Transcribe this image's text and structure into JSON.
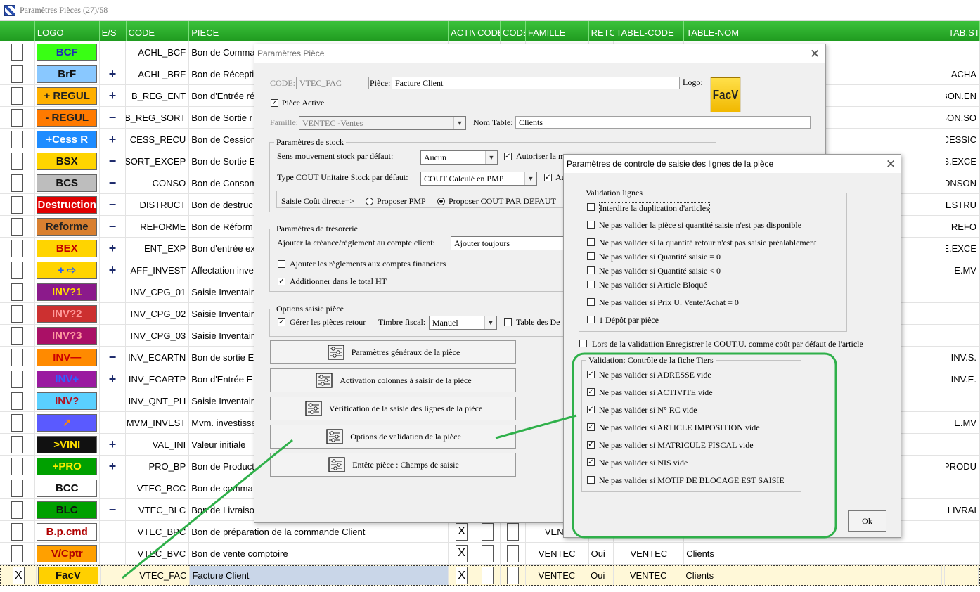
{
  "window": {
    "title": "Paramètres Pièces (27)/58"
  },
  "grid": {
    "columns": [
      "",
      "LOGO",
      "E/S",
      "CODE",
      "PIECE",
      "ACTIV",
      "CODE",
      "CODE",
      "FAMILLE",
      "RETO",
      "TABEL-CODE",
      "TABLE-NOM",
      "",
      "TAB.STO"
    ],
    "rows": [
      {
        "chk": "",
        "logo": "BCF",
        "es": "",
        "code": "ACHL_BCF",
        "piece": "Bon de Comma",
        "tab": ""
      },
      {
        "chk": "",
        "logo": "BrF",
        "es": "+",
        "code": "ACHL_BRF",
        "piece": "Bon de Récepti",
        "tab": "ACHA"
      },
      {
        "chk": "",
        "logo": "+ REGUL",
        "es": "+",
        "code": "B_REG_ENT",
        "piece": "Bon d'Entrée ré",
        "tab": "BON.EN"
      },
      {
        "chk": "",
        "logo": "- REGUL",
        "es": "−",
        "code": "B_REG_SORT",
        "piece": "Bon de Sortie r",
        "tab": "BON.SO"
      },
      {
        "chk": "",
        "logo": "+Cess R",
        "es": "+",
        "code": "CESS_RECU",
        "piece": "Bon de Cession",
        "tab": "CESSIC"
      },
      {
        "chk": "",
        "logo": "BSX",
        "es": "−",
        "code": "SORT_EXCEP",
        "piece": "Bon de Sortie E",
        "tab": "S.EXCE"
      },
      {
        "chk": "",
        "logo": "BCS",
        "es": "−",
        "code": "CONSO",
        "piece": "Bon de Consom",
        "tab": "CONSON"
      },
      {
        "chk": "",
        "logo": "Destruction",
        "es": "−",
        "code": "DISTRUCT",
        "piece": "Bon de destruc",
        "tab": "DESTRU"
      },
      {
        "chk": "",
        "logo": "Reforme",
        "es": "−",
        "code": "REFORME",
        "piece": "Bon de Réform",
        "tab": "REFO"
      },
      {
        "chk": "",
        "logo": "BEX",
        "es": "+",
        "code": "ENT_EXP",
        "piece": "Bon d'entrée ex",
        "tab": "E.EXCE"
      },
      {
        "chk": "",
        "logo": "+ ⇨",
        "es": "+",
        "code": "AFF_INVEST",
        "piece": "Affectation inve",
        "tab": "E.MV"
      },
      {
        "chk": "",
        "logo": "INV?1",
        "es": "",
        "code": "INV_CPG_01",
        "piece": "Saisie Inventair",
        "tab": ""
      },
      {
        "chk": "",
        "logo": "INV?2",
        "es": "",
        "code": "INV_CPG_02",
        "piece": "Saisie Inventair",
        "tab": ""
      },
      {
        "chk": "",
        "logo": "INV?3",
        "es": "",
        "code": "INV_CPG_03",
        "piece": "Saisie Inventair",
        "tab": ""
      },
      {
        "chk": "",
        "logo": "INV—",
        "es": "−",
        "code": "INV_ECARTN",
        "piece": "Bon de sortie E",
        "tab": "INV.S."
      },
      {
        "chk": "",
        "logo": "INV+",
        "es": "+",
        "code": "INV_ECARTP",
        "piece": "Bon d'Entrée E",
        "tab": "INV.E."
      },
      {
        "chk": "",
        "logo": "INV?",
        "es": "",
        "code": "INV_QNT_PH",
        "piece": "Saisie Inventair",
        "tab": ""
      },
      {
        "chk": "",
        "logo": "↗",
        "es": "",
        "code": "MVM_INVEST",
        "piece": "Mvm. investisse",
        "tab": "E.MV"
      },
      {
        "chk": "",
        "logo": ">VINI",
        "es": "+",
        "code": "VAL_INI",
        "piece": "Valeur initiale",
        "tab": ""
      },
      {
        "chk": "",
        "logo": "+PRO",
        "es": "+",
        "code": "PRO_BP",
        "piece": "Bon de Product",
        "tab": "PRODU"
      },
      {
        "chk": "",
        "logo": "BCC",
        "es": "",
        "code": "VTEC_BCC",
        "piece": "Bon de comma",
        "tab": ""
      },
      {
        "chk": "",
        "logo": "BLC",
        "es": "−",
        "code": "VTEC_BLC",
        "piece": "Bon de Livraiso",
        "tab": "LIVRAI"
      },
      {
        "chk": "",
        "logo": "B.p.cmd",
        "es": "",
        "code": "VTEC_BPC",
        "piece": "Bon de préparation de la commande Client",
        "activ": "X",
        "famille": "VENT",
        "reto": "",
        "tabelcode": "",
        "tablenom": "",
        "tab": ""
      },
      {
        "chk": "",
        "logo": "V/Cptr",
        "es": "",
        "code": "VTEC_BVC",
        "piece": "Bon de vente comptoire",
        "activ": "X",
        "famille": "VENTEC",
        "reto": "Oui",
        "tabelcode": "VENTEC",
        "tablenom": "Clients",
        "tab": ""
      },
      {
        "chk": "X",
        "logo": "FacV",
        "es": "",
        "code": "VTEC_FAC",
        "piece": "Facture Client",
        "activ": "X",
        "famille": "VENTEC",
        "reto": "Oui",
        "tabelcode": "VENTEC",
        "tablenom": "Clients",
        "tab": ""
      }
    ]
  },
  "dialog_piece": {
    "title": "Paramètres Pièce",
    "code_label": "CODE:",
    "code_value": "VTEC_FAC",
    "piece_label": "Pièce:",
    "piece_value": "Facture Client",
    "logo_label": "Logo:",
    "logo_text": "FacV",
    "active_label": "Pièce Active",
    "famille_label": "Famille:",
    "famille_value": "VENTEC   -Ventes",
    "nomtable_label": "Nom Table:",
    "nomtable_value": "Clients",
    "stock": {
      "title": "Paramètres de stock",
      "sens_label": "Sens mouvement stock par défaut:",
      "sens_value": "Aucun",
      "autoriser_label": "Autoriser la m",
      "cout_label": "Type COUT Unitaire Stock par défaut:",
      "cout_value": "COUT Calculé en PMP",
      "au_label": "Au",
      "saisie_label": "Saisie Coût directe=>",
      "pmp_label": "Proposer PMP",
      "defaut_label": "Proposer COUT PAR DEFAUT"
    },
    "treso": {
      "title": "Paramètres de trésorerie",
      "creance_label": "Ajouter la créance/réglement au compte client:",
      "creance_value": "Ajouter toujours",
      "reglements_label": "Ajouter les règlements aux comptes financiers",
      "additionner_label": "Additionner dans le total HT"
    },
    "options": {
      "title": "Options saisie pièce",
      "retour_label": "Gérer les pièces retour",
      "timbre_label": "Timbre fiscal:",
      "timbre_value": "Manuel",
      "tabledes_label": "Table des De"
    },
    "buttons": [
      "Paramètres généraux de la pièce",
      "Activation colonnes à saisir de la pièce",
      "Vérification  de la saisie des lignes de la pièce",
      "Options de validation de la pièce",
      "Entête pièce : Champs de saisie"
    ]
  },
  "dialog_controle": {
    "title": "Paramètres de controle de saisie des lignes de la pièce",
    "lignes_title": "Validation lignes",
    "lignes": [
      {
        "label": "Interdire la duplication d'articles",
        "checked": false
      },
      {
        "label": "Ne pas valider la pièce si quantité saisie n'est pas disponible",
        "checked": false
      },
      {
        "label": "Ne pas valider si la quantité retour n'est pas saisie préalablement",
        "checked": false
      },
      {
        "label": "Ne pas valider si Quantité saisie = 0",
        "checked": false
      },
      {
        "label": "Ne pas valider si Quantité saisie < 0",
        "checked": false
      },
      {
        "label": "Ne pas valider si Article Bloqué",
        "checked": false
      },
      {
        "label": "Ne pas valider si Prix U. Vente/Achat = 0",
        "checked": false
      },
      {
        "label": "1 Dépôt par pièce",
        "checked": false
      }
    ],
    "enregistrer_label": "Lors de la validatiion Enregistrer le COUT.U. comme coût par défaut de l'article",
    "tiers_title": "Validation: Contrôle de la fiche  Tiers",
    "tiers": [
      {
        "label": "Ne pas valider si ADRESSE vide",
        "checked": true
      },
      {
        "label": "Ne pas valider si ACTIVITE vide",
        "checked": true
      },
      {
        "label": "Ne pas valider si N° RC vide",
        "checked": true
      },
      {
        "label": "Ne pas valider si ARTICLE IMPOSITION vide",
        "checked": true
      },
      {
        "label": "Ne pas valider si MATRICULE FISCAL vide",
        "checked": true
      },
      {
        "label": "Ne pas valider si NIS vide",
        "checked": true
      },
      {
        "label": "Ne pas valider si MOTIF DE BLOCAGE EST SAISIE",
        "checked": false
      }
    ],
    "ok_label": "Ok"
  },
  "colors": {
    "header_green": "#1f9a1f",
    "annotation_green": "#2fb04a",
    "selected_row": "#fff8d8"
  }
}
